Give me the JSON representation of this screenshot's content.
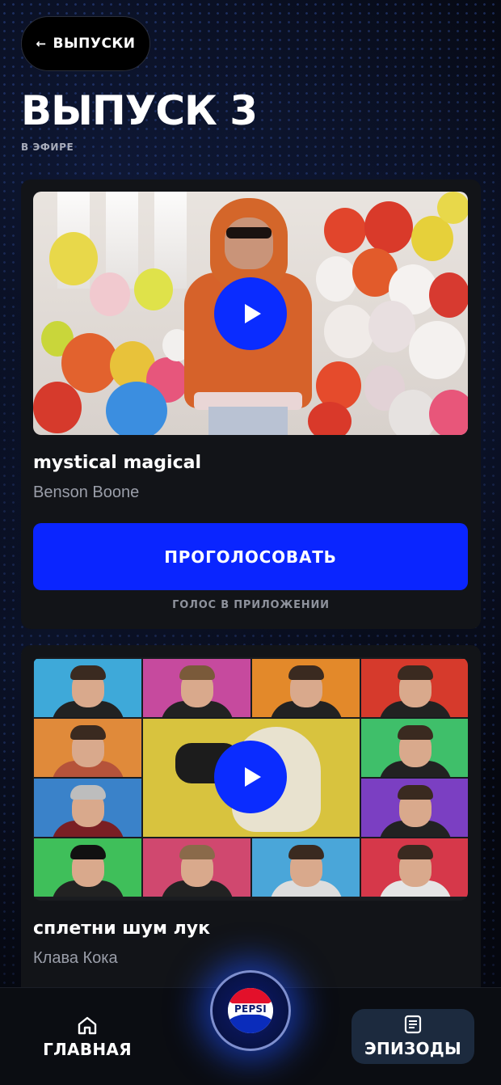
{
  "header": {
    "back_label": "ВЫПУСКИ",
    "back_arrow": "←",
    "title": "ВЫПУСК 3",
    "status": "В ЭФИРЕ"
  },
  "cards": [
    {
      "song_title": "mystical magical",
      "artist": "Benson Boone",
      "vote_label": "ПРОГОЛОСОВАТЬ",
      "vote_note": "ГОЛОС В ПРИЛОЖЕНИИ"
    },
    {
      "song_title": "сплетни шум лук",
      "artist": "Клава Кока"
    }
  ],
  "nav": {
    "home_label": "ГЛАВНАЯ",
    "episodes_label": "ЭПИЗОДЫ",
    "brand_label": "PEPSI"
  },
  "colors": {
    "accent_blue": "#0a25ff",
    "background": "#05070f",
    "card": "#121418",
    "muted_text": "#9a9ea9"
  },
  "icons": [
    "back-arrow-icon",
    "play-icon",
    "home-icon",
    "document-icon",
    "pepsi-logo"
  ]
}
